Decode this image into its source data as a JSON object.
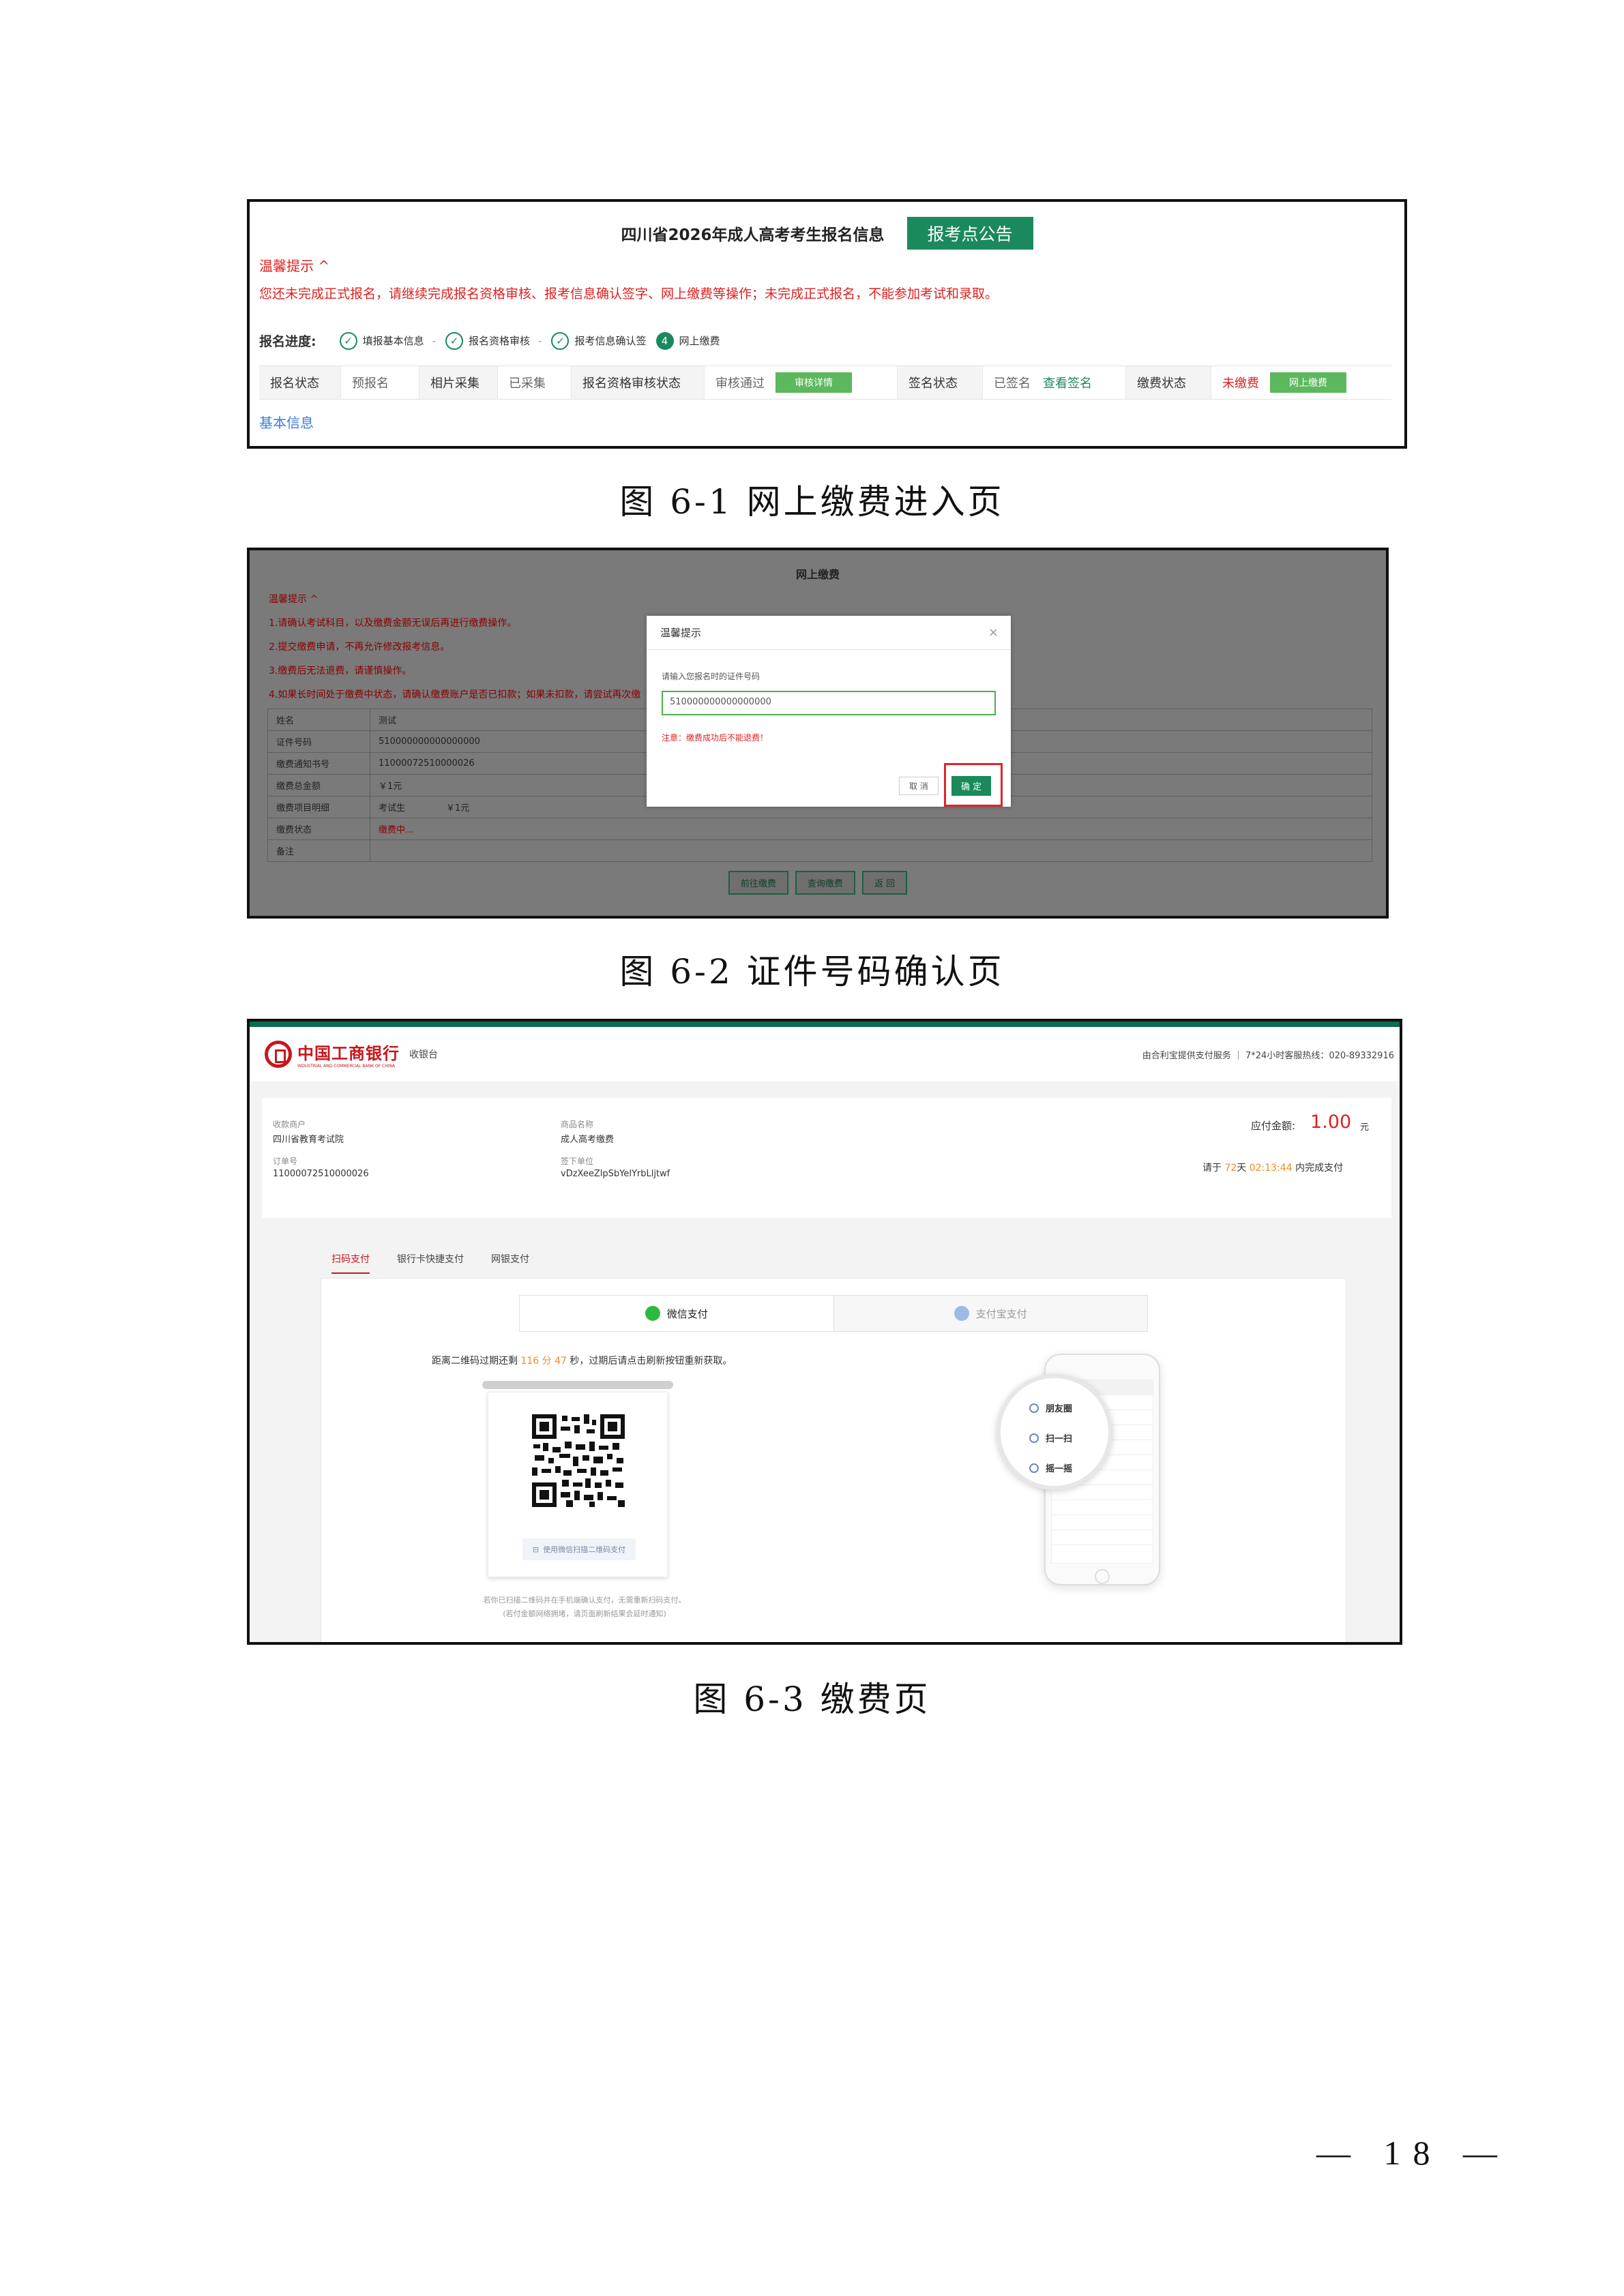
{
  "fig1": {
    "title": "四川省2026年成人高考考生报名信息",
    "notice_button": "报考点公告",
    "tip_head": "温馨提示 ^",
    "tip_text": "您还未完成正式报名，请继续完成报名资格审核、报考信息确认签字、网上缴费等操作；未完成正式报名，不能参加考试和录取。",
    "progress_label": "报名进度:",
    "steps": [
      "填报基本信息",
      "报名资格审核",
      "报考信息确认签",
      "网上缴费"
    ],
    "step4_num": "4",
    "status": {
      "reg_label": "报名状态",
      "reg_value": "预报名",
      "photo_label": "相片采集",
      "photo_value": "已采集",
      "review_label": "报名资格审核状态",
      "review_value": "审核通过",
      "review_btn": "审核详情",
      "sign_label": "签名状态",
      "sign_value": "已签名",
      "sign_link": "查看签名",
      "pay_label": "缴费状态",
      "pay_value": "未缴费",
      "pay_btn": "网上缴费"
    },
    "basic_link": "基本信息"
  },
  "caption1": "图 6-1 网上缴费进入页",
  "fig2": {
    "title": "网上缴费",
    "tips": [
      "温馨提示 ^",
      "1.请确认考试科目，以及缴费金额无误后再进行缴费操作。",
      "2.提交缴费申请，不再允许修改报考信息。",
      "3.缴费后无法退费，请谨慎操作。",
      "4.如果长时间处于缴费中状态，请确认缴费账户是否已扣款；如果未扣款，请尝试再次缴"
    ],
    "table": [
      {
        "k": "姓名",
        "v": "测试"
      },
      {
        "k": "证件号码",
        "v": "510000000000000000"
      },
      {
        "k": "缴费通知书号",
        "v": "11000072510000026"
      },
      {
        "k": "缴费总金额",
        "v": "￥1元"
      },
      {
        "k": "缴费项目明细",
        "v": "考试生",
        "v2": "￥1元"
      },
      {
        "k": "缴费状态",
        "v": "缴费中..."
      },
      {
        "k": "备注",
        "v": ""
      }
    ],
    "buttons": [
      "前往缴费",
      "查询缴费",
      "返 回"
    ],
    "modal": {
      "title": "温馨提示",
      "close": "×",
      "label": "请输入您报名时的证件号码",
      "input_value": "510000000000000000",
      "warning": "注意：缴费成功后不能退费！",
      "cancel": "取 消",
      "ok": "确 定"
    }
  },
  "caption2": "图 6-2 证件号码确认页",
  "fig3": {
    "bank_name": "中国工商银行",
    "bank_en": "INDUSTRIAL AND COMMERCIAL BANK OF CHINA",
    "cashier": "收银台",
    "header_right": "由合利宝提供支付服务 ｜ 7*24小时客服热线：020-89332916",
    "merchant_label": "收款商户",
    "merchant": "四川省教育考试院",
    "goods_label": "商品名称",
    "goods": "成人高考缴费",
    "order_label": "订单号",
    "order": "11000072510000026",
    "remark_label": "签下单位",
    "remark": "vDzXeeZlpSbYelYrbLljtwf",
    "amount_label": "应付金额:",
    "amount": "1.00",
    "amount_unit": "元",
    "deadline_pre": "请于",
    "deadline_days": "72",
    "deadline_day_unit": "天",
    "deadline_time": "02:13:44",
    "deadline_post": "内完成支付",
    "tabs": [
      "扫码支付",
      "银行卡快捷支付",
      "网银支付"
    ],
    "wechat": "微信支付",
    "alipay": "支付宝支付",
    "countdown_pre": "距离二维码过期还剩",
    "countdown_min": "116",
    "countdown_mid": "分",
    "countdown_sec": "47",
    "countdown_post": "秒，过期后请点击刷新按钮重新获取。",
    "qr_hint": "使用微信扫描二维码支付",
    "scanned_1": "若你已扫描二维码并在手机端确认支付，无需重新扫码支付。",
    "scanned_2": "(若付金额网络拥堵，请页面刷新结果会延时通知)",
    "phone_items": [
      "朋友圈",
      "扫一扫",
      "摇一摇"
    ],
    "colors": {
      "green": "#0c6b52",
      "red": "#c8161d",
      "orange": "#f08a24"
    }
  },
  "caption3": "图 6-3 缴费页",
  "page_number": "— 18 —"
}
